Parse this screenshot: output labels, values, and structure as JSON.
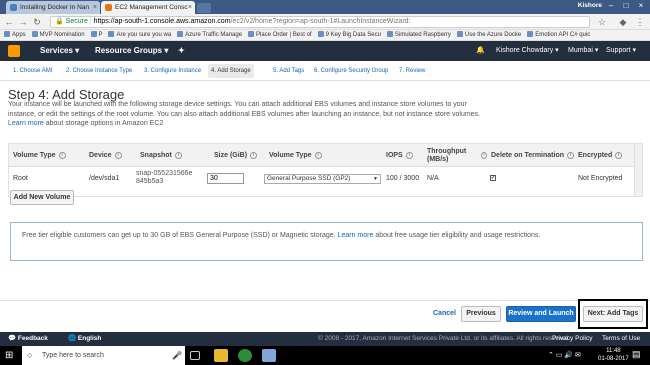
{
  "browser": {
    "tabs": [
      {
        "label": "Installing Docker In Nan",
        "active": false
      },
      {
        "label": "EC2 Management Consc",
        "active": true
      }
    ],
    "profile": "Kishore",
    "url": {
      "secure_label": "Secure",
      "host": "https://ap-south-1.console.aws.amazon.com",
      "path": "/ec2/v2/home?region=ap-south-1#LaunchInstanceWizard:"
    },
    "bookmarks": [
      "Apps",
      "MVP Nomination",
      "P",
      "Are you sure you wa",
      "Azure Traffic Manage",
      "Place Order | Best of",
      "9 Key Big Data Secu",
      "Simulated Raspberry",
      "Use the Azure Docke",
      "Emotion API C# quic"
    ]
  },
  "aws_nav": {
    "services": "Services",
    "resource_groups": "Resource Groups",
    "user": "Kishore Chowdary",
    "region": "Mumbai",
    "support": "Support"
  },
  "steps": [
    {
      "label": "1. Choose AMI",
      "active": false
    },
    {
      "label": "2. Choose Instance Type",
      "active": false
    },
    {
      "label": "3. Configure Instance",
      "active": false
    },
    {
      "label": "4. Add Storage",
      "active": true
    },
    {
      "label": "5. Add Tags",
      "active": false
    },
    {
      "label": "6. Configure Security Group",
      "active": false
    },
    {
      "label": "7. Review",
      "active": false
    }
  ],
  "page": {
    "title": "Step 4: Add Storage",
    "intro": "Your instance will be launched with the following storage device settings. You can attach additional EBS volumes and instance store volumes to your instance, or edit the settings of the root volume. You can also attach additional EBS volumes after launching an instance, but not instance store volumes.",
    "learn_more": "Learn more",
    "intro_tail": "about storage options in Amazon EC2"
  },
  "table": {
    "headers": [
      "Volume Type",
      "Device",
      "Snapshot",
      "Size (GiB)",
      "Volume Type",
      "IOPS",
      "Throughput (MB/s)",
      "Delete on Termination",
      "Encrypted"
    ],
    "row": {
      "volume_type": "Root",
      "device": "/dev/sda1",
      "snapshot": "snap-055231566e845b5a3",
      "size": "30",
      "ebs_type": "General Purpose SSD (GP2)",
      "iops": "100 / 3000",
      "throughput": "N/A",
      "delete_on_termination": true,
      "encrypted": "Not Encrypted"
    }
  },
  "add_volume": "Add New Volume",
  "notice": {
    "text": "Free tier eligible customers can get up to 30 GB of EBS General Purpose (SSD) or Magnetic storage.",
    "learn_more": "Learn more",
    "tail": "about free usage tier eligibility and usage restrictions."
  },
  "actions": {
    "cancel": "Cancel",
    "previous": "Previous",
    "review": "Review and Launch",
    "next": "Next: Add Tags"
  },
  "footer": {
    "feedback": "Feedback",
    "language": "English",
    "copyright": "© 2008 - 2017, Amazon Internet Services Private Ltd. or its affiliates. All rights reserved.",
    "privacy": "Privacy Policy",
    "terms": "Terms of Use"
  },
  "taskbar": {
    "search_placeholder": "Type here to search",
    "time": "11:48",
    "date": "01-08-2017"
  },
  "colors": {
    "aws_nav": "#232f3e",
    "link": "#1166bb",
    "primary_button": "#1a73c8"
  }
}
